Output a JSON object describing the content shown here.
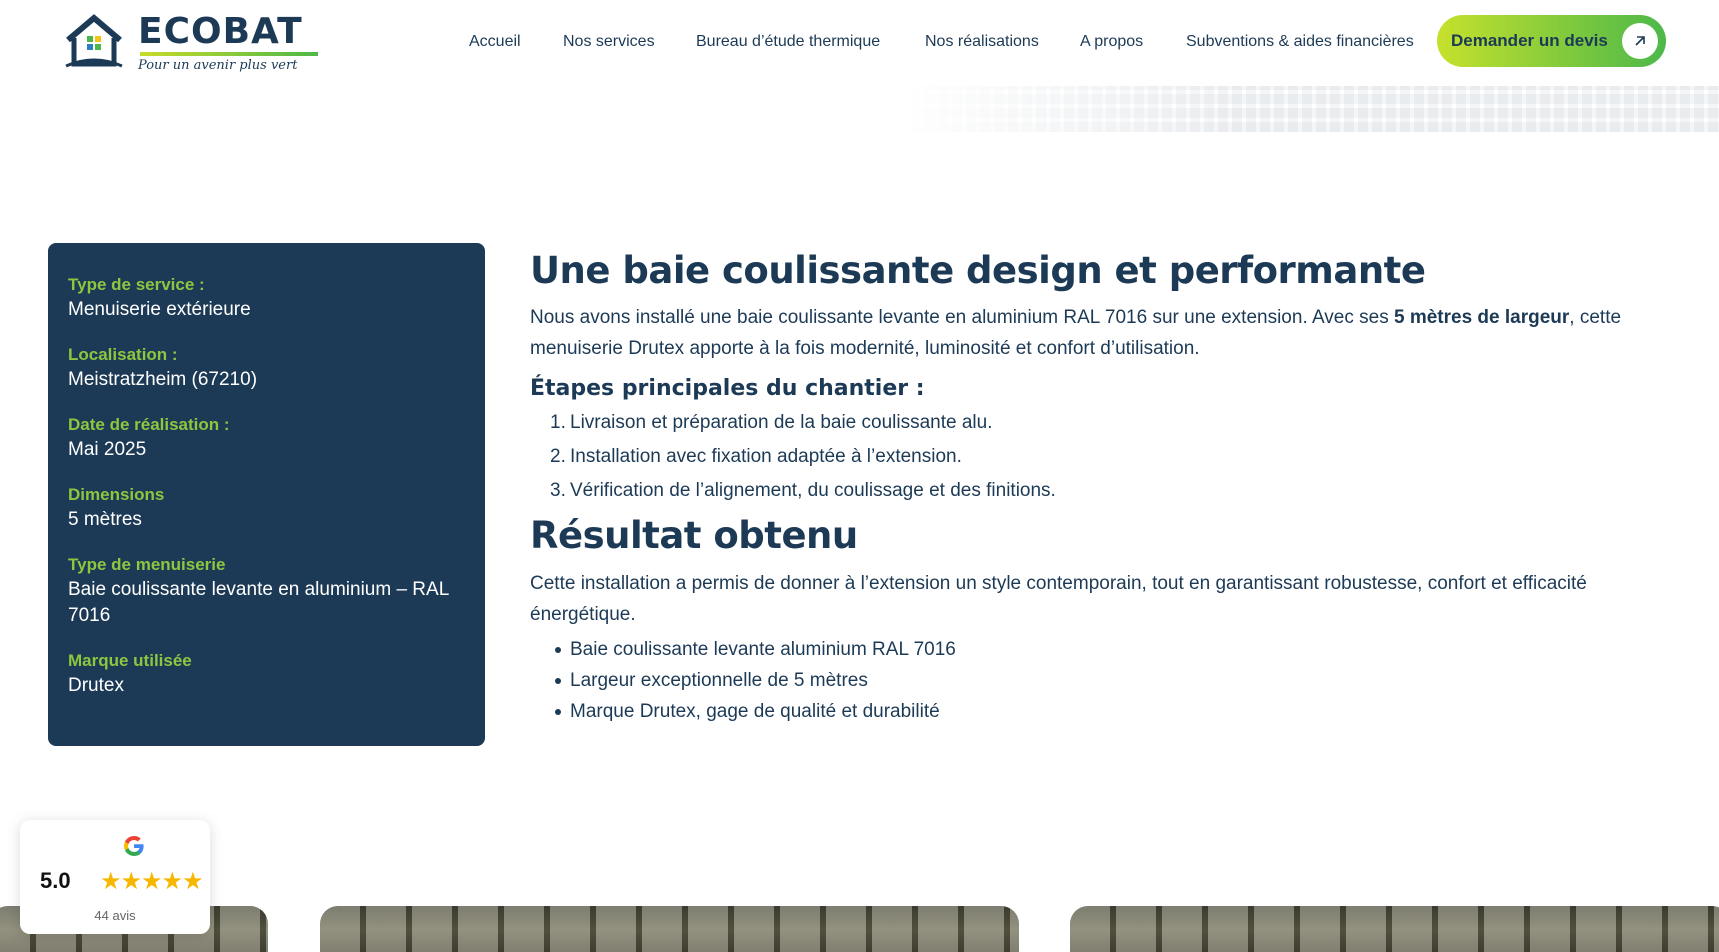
{
  "header": {
    "brand": "ECOBAT",
    "tagline": "Pour un avenir plus vert",
    "nav": [
      {
        "label": "Accueil"
      },
      {
        "label": "Nos services"
      },
      {
        "label": "Bureau d’étude thermique"
      },
      {
        "label": "Nos réalisations"
      },
      {
        "label": "A propos"
      },
      {
        "label": "Subventions & aides financières"
      }
    ],
    "cta_label": "Demander un devis"
  },
  "info": {
    "items": [
      {
        "label": "Type de service :",
        "value": "Menuiserie extérieure"
      },
      {
        "label": "Localisation :",
        "value": "Meistratzheim (67210)"
      },
      {
        "label": "Date de réalisation :",
        "value": "Mai 2025"
      },
      {
        "label": "Dimensions",
        "value": "5 mètres"
      },
      {
        "label": "Type de menuiserie",
        "value": "Baie coulissante levante en aluminium – RAL 7016"
      },
      {
        "label": "Marque utilisée",
        "value": "Drutex"
      }
    ]
  },
  "content": {
    "title": "Une baie coulissante design et performante",
    "intro_before": "Nous avons installé une baie coulissante levante en aluminium RAL 7016 sur une extension. Avec ses ",
    "intro_bold": "5 mètres de largeur",
    "intro_after": ", cette menuiserie Drutex apporte à la fois modernité, luminosité et confort d’utilisation.",
    "steps_title": "Étapes principales du chantier :",
    "steps": [
      {
        "num": "1.",
        "text": "Livraison et préparation de la baie coulissante alu."
      },
      {
        "num": "2.",
        "text": "Installation avec fixation adaptée à l’extension."
      },
      {
        "num": "3.",
        "text": "Vérification de l’alignement, du coulissage et des finitions."
      }
    ],
    "result_title": "Résultat obtenu",
    "result_text": "Cette installation a permis de donner à l’extension un style contemporain, tout en garantissant robustesse, confort et efficacité énergétique.",
    "bullets": [
      "Baie coulissante levante aluminium RAL 7016",
      "Largeur exceptionnelle de 5 mètres",
      "Marque Drutex, gage de qualité et durabilité"
    ]
  },
  "review": {
    "score": "5.0",
    "stars": "★★★★★",
    "count": "44 avis",
    "rating_fraction": 1.0
  },
  "colors": {
    "navy": "#1c3a56",
    "green": "#8dc63f",
    "cta_start": "#c6e12c",
    "cta_end": "#4cb84a",
    "star": "#f6b700"
  }
}
